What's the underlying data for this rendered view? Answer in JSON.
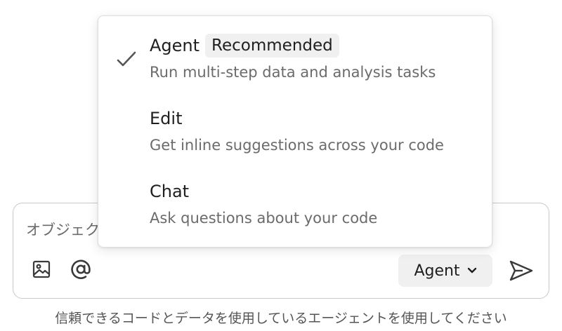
{
  "menu": {
    "selected_index": 0,
    "items": [
      {
        "title": "Agent",
        "badge": "Recommended",
        "description": "Run multi-step data and analysis tasks",
        "selected": true
      },
      {
        "title": "Edit",
        "description": "Get inline suggestions across your code",
        "selected": false
      },
      {
        "title": "Chat",
        "description": "Ask questions about your code",
        "selected": false
      }
    ]
  },
  "composer": {
    "input_placeholder": "オブジェク",
    "mode_label": "Agent",
    "icons": {
      "image": "image-icon",
      "mention": "at-sign-icon",
      "mode_chevron": "chevron-down-icon",
      "send": "send-icon",
      "check": "check-icon"
    }
  },
  "disclaimer": "信頼できるコードとデータを使用しているエージェントを使用してください",
  "colors": {
    "border": "#c9c9c9",
    "button_bg": "#f0f0f0",
    "text_primary": "#1f1f1f",
    "text_secondary": "#6b6b6b"
  }
}
